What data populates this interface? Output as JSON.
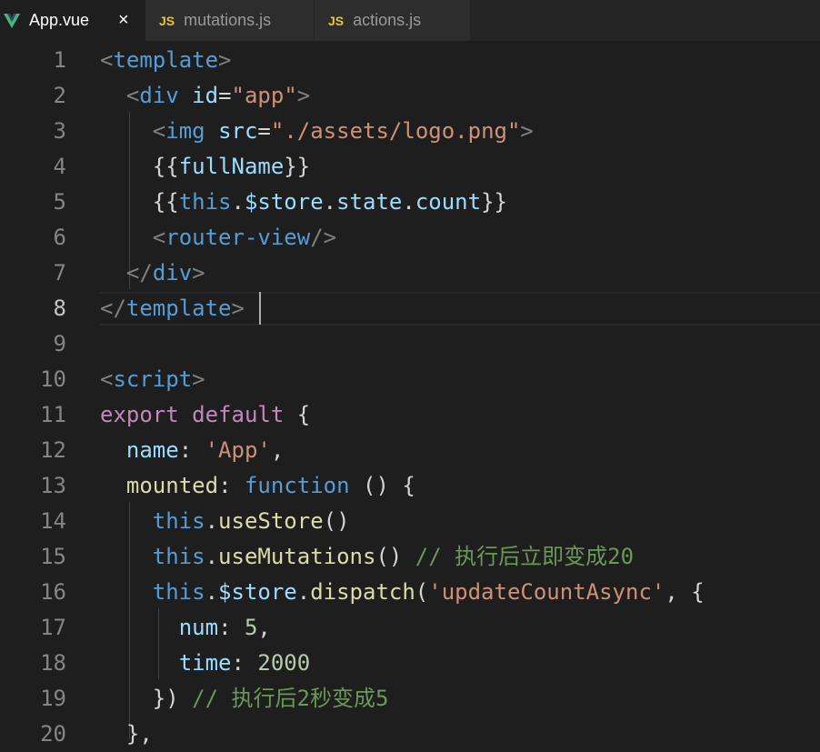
{
  "tabs": [
    {
      "label": "App.vue",
      "icon": "vue-icon",
      "active": true
    },
    {
      "label": "mutations.js",
      "icon": "JS",
      "active": false
    },
    {
      "label": "actions.js",
      "icon": "JS",
      "active": false
    }
  ],
  "close_glyph": "×",
  "line_numbers": [
    "1",
    "2",
    "3",
    "4",
    "5",
    "6",
    "7",
    "8",
    "9",
    "10",
    "11",
    "12",
    "13",
    "14",
    "15",
    "16",
    "17",
    "18",
    "19",
    "20"
  ],
  "code_lines": [
    [
      {
        "t": "<",
        "c": "t-tag"
      },
      {
        "t": "template",
        "c": "t-name"
      },
      {
        "t": ">",
        "c": "t-tag"
      }
    ],
    [
      {
        "t": "  "
      },
      {
        "t": "<",
        "c": "t-tag"
      },
      {
        "t": "div",
        "c": "t-name"
      },
      {
        "t": " "
      },
      {
        "t": "id",
        "c": "t-attr"
      },
      {
        "t": "=",
        "c": "t-p"
      },
      {
        "t": "\"app\"",
        "c": "t-str"
      },
      {
        "t": ">",
        "c": "t-tag"
      }
    ],
    [
      {
        "t": "    "
      },
      {
        "t": "<",
        "c": "t-tag"
      },
      {
        "t": "img",
        "c": "t-name"
      },
      {
        "t": " "
      },
      {
        "t": "src",
        "c": "t-attr"
      },
      {
        "t": "=",
        "c": "t-p"
      },
      {
        "t": "\"./assets/logo.png\"",
        "c": "t-str"
      },
      {
        "t": ">",
        "c": "t-tag"
      }
    ],
    [
      {
        "t": "    "
      },
      {
        "t": "{{",
        "c": "t-p"
      },
      {
        "t": "fullName",
        "c": "t-var"
      },
      {
        "t": "}}",
        "c": "t-p"
      }
    ],
    [
      {
        "t": "    "
      },
      {
        "t": "{{",
        "c": "t-p"
      },
      {
        "t": "this",
        "c": "t-kw2"
      },
      {
        "t": ".",
        "c": "t-p"
      },
      {
        "t": "$store",
        "c": "t-var"
      },
      {
        "t": ".",
        "c": "t-p"
      },
      {
        "t": "state",
        "c": "t-var"
      },
      {
        "t": ".",
        "c": "t-p"
      },
      {
        "t": "count",
        "c": "t-var"
      },
      {
        "t": "}}",
        "c": "t-p"
      }
    ],
    [
      {
        "t": "    "
      },
      {
        "t": "<",
        "c": "t-tag"
      },
      {
        "t": "router-view",
        "c": "t-name"
      },
      {
        "t": "/>",
        "c": "t-tag"
      }
    ],
    [
      {
        "t": "  "
      },
      {
        "t": "</",
        "c": "t-tag"
      },
      {
        "t": "div",
        "c": "t-name"
      },
      {
        "t": ">",
        "c": "t-tag"
      }
    ],
    [
      {
        "t": "</",
        "c": "t-tag"
      },
      {
        "t": "template",
        "c": "t-name"
      },
      {
        "t": ">",
        "c": "t-tag"
      }
    ],
    [],
    [
      {
        "t": "<",
        "c": "t-tag"
      },
      {
        "t": "script",
        "c": "t-name"
      },
      {
        "t": ">",
        "c": "t-tag"
      }
    ],
    [
      {
        "t": "export",
        "c": "t-kw"
      },
      {
        "t": " "
      },
      {
        "t": "default",
        "c": "t-kw"
      },
      {
        "t": " {",
        "c": "t-p"
      }
    ],
    [
      {
        "t": "  "
      },
      {
        "t": "name",
        "c": "t-var"
      },
      {
        "t": ": ",
        "c": "t-p"
      },
      {
        "t": "'App'",
        "c": "t-str"
      },
      {
        "t": ",",
        "c": "t-p"
      }
    ],
    [
      {
        "t": "  "
      },
      {
        "t": "mounted",
        "c": "t-fn"
      },
      {
        "t": ": ",
        "c": "t-p"
      },
      {
        "t": "function",
        "c": "t-kw2"
      },
      {
        "t": " () {",
        "c": "t-p"
      }
    ],
    [
      {
        "t": "    "
      },
      {
        "t": "this",
        "c": "t-kw2"
      },
      {
        "t": ".",
        "c": "t-p"
      },
      {
        "t": "useStore",
        "c": "t-fn"
      },
      {
        "t": "()",
        "c": "t-p"
      }
    ],
    [
      {
        "t": "    "
      },
      {
        "t": "this",
        "c": "t-kw2"
      },
      {
        "t": ".",
        "c": "t-p"
      },
      {
        "t": "useMutations",
        "c": "t-fn"
      },
      {
        "t": "() ",
        "c": "t-p"
      },
      {
        "t": "// 执行后立即变成20",
        "c": "t-com"
      }
    ],
    [
      {
        "t": "    "
      },
      {
        "t": "this",
        "c": "t-kw2"
      },
      {
        "t": ".",
        "c": "t-p"
      },
      {
        "t": "$store",
        "c": "t-var"
      },
      {
        "t": ".",
        "c": "t-p"
      },
      {
        "t": "dispatch",
        "c": "t-fn"
      },
      {
        "t": "(",
        "c": "t-p"
      },
      {
        "t": "'updateCountAsync'",
        "c": "t-str"
      },
      {
        "t": ", {",
        "c": "t-p"
      }
    ],
    [
      {
        "t": "      "
      },
      {
        "t": "num",
        "c": "t-var"
      },
      {
        "t": ": ",
        "c": "t-p"
      },
      {
        "t": "5",
        "c": "t-num"
      },
      {
        "t": ",",
        "c": "t-p"
      }
    ],
    [
      {
        "t": "      "
      },
      {
        "t": "time",
        "c": "t-var"
      },
      {
        "t": ": ",
        "c": "t-p"
      },
      {
        "t": "2000",
        "c": "t-num"
      }
    ],
    [
      {
        "t": "    "
      },
      {
        "t": "}) ",
        "c": "t-p"
      },
      {
        "t": "// 执行后2秒变成5",
        "c": "t-com"
      }
    ],
    [
      {
        "t": "  "
      },
      {
        "t": "},",
        "c": "t-p"
      }
    ]
  ],
  "current_line": 8,
  "colors": {
    "background": "#1e1e1e",
    "tag": "#808080",
    "tag_name": "#569cd6",
    "attribute": "#9cdcfe",
    "string": "#ce9178",
    "keyword": "#c586c0",
    "function": "#dcdcaa",
    "number": "#b5cea8",
    "comment": "#6a9955",
    "vue_green": "#41b883",
    "js_yellow": "#e8c63a"
  }
}
